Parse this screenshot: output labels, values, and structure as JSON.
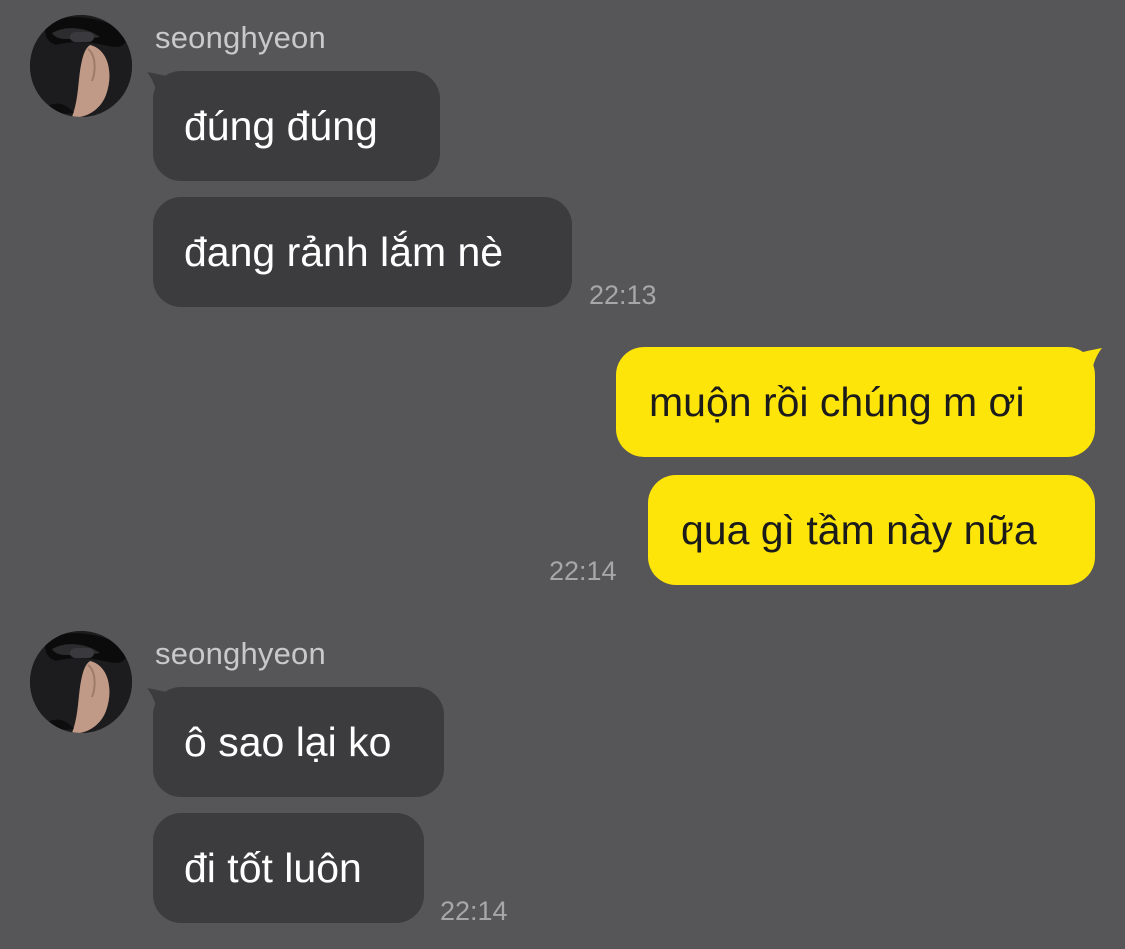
{
  "colors": {
    "background": "#565557",
    "incoming_bubble": "#3c3b3d",
    "outgoing_bubble": "#fde50a",
    "sender_name": "#c9c9cb",
    "timestamp": "#a7a6a9"
  },
  "messages": [
    {
      "direction": "incoming",
      "sender": "seonghyeon",
      "avatar_icon": "profile-photo",
      "bubbles": [
        "đúng đúng",
        "đang rảnh lắm nè"
      ],
      "time": "22:13"
    },
    {
      "direction": "outgoing",
      "bubbles": [
        "muộn rồi chúng m ơi",
        "qua gì tầm này nữa"
      ],
      "time": "22:14"
    },
    {
      "direction": "incoming",
      "sender": "seonghyeon",
      "avatar_icon": "profile-photo",
      "bubbles": [
        "ô sao lại ko",
        "đi tốt luôn"
      ],
      "time": "22:14"
    }
  ]
}
